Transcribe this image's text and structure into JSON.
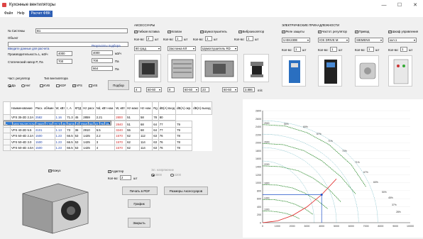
{
  "window": {
    "title": "Кухонные вентиляторы",
    "minimize": "—",
    "maximize": "☐",
    "close": "✕"
  },
  "menu": {
    "file": "Файл",
    "help": "Help",
    "calc": "Расчет ФВК"
  },
  "system": {
    "label_system": "№ Системы",
    "system_value": "В1",
    "label_object": "Объект",
    "object_value": ""
  },
  "input": {
    "header": "Введите данные для расчета",
    "flow_label": "Производительность L, м3/ч",
    "flow_value": "4000",
    "pressure_label": "Статический напор P, Па",
    "pressure_value": "700"
  },
  "results": {
    "header": "Результаты подбора",
    "r1": "4000",
    "u1": "м3/ч",
    "r2": "700",
    "u2": "Па",
    "r3": "664",
    "u3": "Па"
  },
  "regulator": {
    "label": "Част. регулятор",
    "yes": "Да",
    "no": "Нет"
  },
  "fan_type": {
    "label": "Тип вентилятора",
    "types": [
      "KVB",
      "KDF",
      "VFS",
      "VIS"
    ],
    "select_button": "Подбор"
  },
  "accessories": {
    "header": "АКСЕССУАРЫ",
    "flex_label": "Гибкая вставка",
    "valve_label": "Клапан",
    "silencer_label": "Шумоглушитель",
    "vibro_label": "Виброизолятор",
    "qty_label": "Кол-во:",
    "qty_unit": "шт",
    "qty1": "2",
    "qty2": "1",
    "qty3": "1",
    "qty4": "1",
    "sel1": "80 град",
    "sel2": "Заслонка КЛ",
    "sel3": "Шумоглушитель RD",
    "row_a": "4",
    "row_b": "60-60",
    "row_c": "9",
    "row_d": "60-60",
    "row_e": "23",
    "row_f": "60-60",
    "row_g": "3.886",
    "row_unit": "m/c"
  },
  "electrical": {
    "header": "ЭЛЕКТРИЧЕСКИЕ ПРИНАДЛЕЖНОСТИ",
    "relay_label": "Реле защиты",
    "freq_label": "Частот. регулятор",
    "drive_label": "Привод",
    "panel_label": "Шкаф управления",
    "sel1": "U-EK230E",
    "sel2": "IOS DRIVE M",
    "sel3": "SIEMENS",
    "sel4": "кол.1",
    "qty_label": "Кол-во:",
    "qty_unit": "шт",
    "qty1": "1",
    "qty2": "1",
    "qty3": "1",
    "qty4": "1"
  },
  "table": {
    "headers": [
      "Наименование",
      "Расх. об/мин",
      "W, кВт",
      "I, А",
      "КПД",
      "Hz расх",
      "Nd, кВт ном.",
      "W, кВт",
      "Hz макс",
      "Hz ном.",
      "Rg",
      "dB(A) вход",
      "dB(A) окр.",
      "dB(A) выход"
    ],
    "rows": [
      [
        "VFS 35-2D 2.2л",
        "2582",
        "1.16",
        "71.3",
        "45",
        "2859",
        "2.21",
        "2800",
        "51",
        "58",
        "78",
        "80"
      ],
      [
        "VFS 35-2D 3.0л",
        "2582",
        "1.16",
        "71.3",
        "45",
        "3635",
        "3",
        "3260",
        "56",
        "61",
        "78",
        "80"
      ],
      [
        "VFS 40-2D 4.0л",
        "2101",
        "1.13",
        "73",
        "36",
        "2035",
        "4",
        "2840",
        "51",
        "68",
        "64",
        "77",
        "79"
      ],
      [
        "VFS 40-2D 5.5",
        "2101",
        "1.13",
        "73",
        "36",
        "2910",
        "5.5",
        "3240",
        "55",
        "68",
        "64",
        "77",
        "79"
      ],
      [
        "VFS 50-4D 2.2л",
        "1500",
        "1.23",
        "66.5",
        "53",
        "1425",
        "2.2",
        "1570",
        "62",
        "112",
        "63",
        "76",
        "78"
      ],
      [
        "VFS 50-4D 3.0",
        "1500",
        "1.23",
        "66.5",
        "53",
        "1425",
        "3",
        "1570",
        "62",
        "114",
        "63",
        "76",
        "78"
      ],
      [
        "VFS 50-4D 4.0л",
        "1500",
        "1.23",
        "66.5",
        "53",
        "1425",
        "4",
        "1570",
        "62",
        "114",
        "63",
        "76",
        "78"
      ]
    ]
  },
  "bottom": {
    "casing": "Кожух",
    "adapter": "Адаптер",
    "adapter_qty": "2",
    "qty_label": "Кол-во:",
    "qty_unit": "шт",
    "voltage_label": "Эл. напряжение",
    "v1": "3000",
    "v2": "2200",
    "pdf_button": "Печать в PDF",
    "sizes_button": "Размеры Аксессуаров",
    "graph_button": "График",
    "close_button": "Закрыть"
  },
  "chart_data": {
    "type": "line",
    "x_ticks": [
      "0",
      "1000",
      "2000",
      "3000",
      "4000",
      "5000",
      "6000",
      "7000",
      "8000",
      "9000",
      "10000"
    ],
    "y_ticks": [
      "0",
      "200",
      "400",
      "600",
      "800",
      "1000",
      "1200",
      "1400",
      "1600",
      "1800",
      "2000",
      "2200",
      "2400",
      "2600",
      "2800"
    ],
    "xlim": [
      0,
      10000
    ],
    "ylim": [
      0,
      2800
    ],
    "operating_point": {
      "x": 4000,
      "y": 700
    },
    "series": [
      {
        "name": "2900",
        "color": "#2a8a2a",
        "points": [
          [
            0,
            2450
          ],
          [
            1500,
            2420
          ],
          [
            3000,
            2250
          ],
          [
            4500,
            1950
          ],
          [
            6000,
            1450
          ],
          [
            7000,
            900
          ]
        ]
      },
      {
        "name": "2600",
        "color": "#2a8a2a",
        "points": [
          [
            0,
            1980
          ],
          [
            1400,
            1950
          ],
          [
            2800,
            1800
          ],
          [
            4000,
            1550
          ],
          [
            5300,
            1150
          ],
          [
            6300,
            720
          ]
        ]
      },
      {
        "name": "2200",
        "color": "#2a8a2a",
        "points": [
          [
            0,
            1420
          ],
          [
            1200,
            1400
          ],
          [
            2400,
            1300
          ],
          [
            3400,
            1120
          ],
          [
            4500,
            830
          ],
          [
            5300,
            520
          ]
        ]
      },
      {
        "name": "1800",
        "color": "#2a8a2a",
        "points": [
          [
            0,
            950
          ],
          [
            1000,
            940
          ],
          [
            2000,
            870
          ],
          [
            2800,
            750
          ],
          [
            3700,
            560
          ],
          [
            4400,
            350
          ]
        ]
      },
      {
        "name": "1400",
        "color": "#2a8a2a",
        "points": [
          [
            0,
            580
          ],
          [
            800,
            575
          ],
          [
            1600,
            530
          ],
          [
            2200,
            460
          ],
          [
            2900,
            340
          ],
          [
            3400,
            210
          ]
        ]
      },
      {
        "name": "1000",
        "color": "#2a8a2a",
        "points": [
          [
            0,
            290
          ],
          [
            600,
            287
          ],
          [
            1100,
            265
          ],
          [
            1600,
            230
          ],
          [
            2100,
            170
          ],
          [
            2500,
            100
          ]
        ]
      },
      {
        "name": "system",
        "color": "#e02020",
        "points": [
          [
            0,
            0
          ],
          [
            1000,
            44
          ],
          [
            2000,
            175
          ],
          [
            3000,
            394
          ],
          [
            4000,
            700
          ],
          [
            5000,
            1094
          ]
        ]
      }
    ],
    "efficiency_labels": [
      "50%",
      "60%",
      "67%",
      "71%",
      "72%",
      "71%",
      "67%",
      "60%",
      "50%",
      "45%",
      "37%",
      "28%"
    ]
  }
}
